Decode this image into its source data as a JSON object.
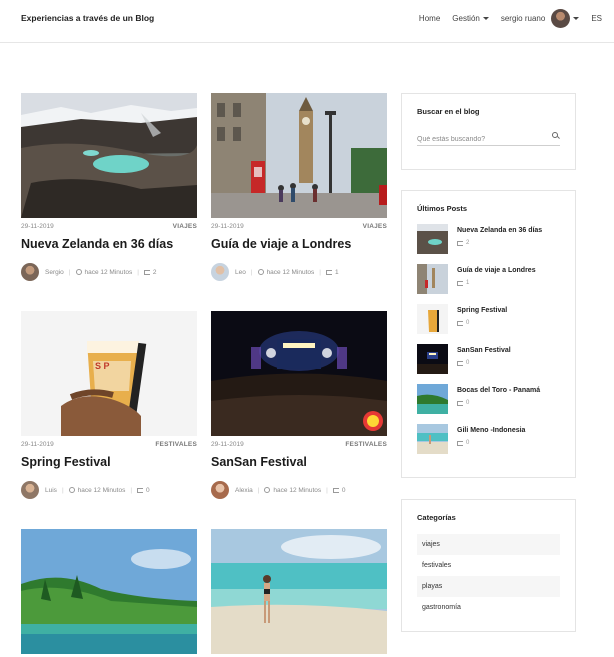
{
  "header": {
    "brand": "Experiencias a través de un Blog",
    "nav_home": "Home",
    "nav_gestion": "Gestión",
    "user_name": "sergio ruano",
    "language": "ES"
  },
  "posts": [
    {
      "date": "29-11-2019",
      "category": "VIAJES",
      "title": "Nueva Zelanda en 36 días",
      "author": "Sergio",
      "time": "hace 12 Minutos",
      "comments": "2"
    },
    {
      "date": "29-11-2019",
      "category": "VIAJES",
      "title": "Guía de viaje a Londres",
      "author": "Leo",
      "time": "hace 12 Minutos",
      "comments": "1"
    },
    {
      "date": "29-11-2019",
      "category": "FESTIVALES",
      "title": "Spring Festival",
      "author": "Luis",
      "time": "hace 12 Minutos",
      "comments": "0"
    },
    {
      "date": "29-11-2019",
      "category": "FESTIVALES",
      "title": "SanSan Festival",
      "author": "Alexia",
      "time": "hace 12 Minutos",
      "comments": "0"
    }
  ],
  "sidebar": {
    "search_title": "Buscar en el blog",
    "search_placeholder": "Qué estás buscando?",
    "latest_title": "Últimos Posts",
    "latest": [
      {
        "title": "Nueva Zelanda en 36 días",
        "count": "2"
      },
      {
        "title": "Guía de viaje a Londres",
        "count": "1"
      },
      {
        "title": "Spring Festival",
        "count": "0"
      },
      {
        "title": "SanSan Festival",
        "count": "0"
      },
      {
        "title": "Bocas del Toro - Panamá",
        "count": "0"
      },
      {
        "title": "Gili Meno -Indonesia",
        "count": "0"
      }
    ],
    "categories_title": "Categorías",
    "categories": [
      "viajes",
      "festivales",
      "playas",
      "gastronomía"
    ]
  }
}
